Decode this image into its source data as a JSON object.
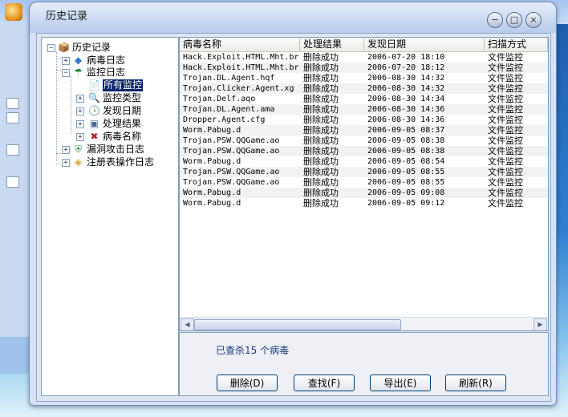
{
  "window": {
    "title": "历史记录"
  },
  "tree": {
    "root": "历史记录",
    "nodes": [
      {
        "label": "病毒日志"
      },
      {
        "label": "监控日志"
      },
      {
        "label": "所有监控"
      },
      {
        "label": "监控类型"
      },
      {
        "label": "发现日期"
      },
      {
        "label": "处理结果"
      },
      {
        "label": "病毒名称"
      },
      {
        "label": "漏洞攻击日志"
      },
      {
        "label": "注册表操作日志"
      }
    ]
  },
  "table": {
    "columns": [
      "病毒名称",
      "处理结果",
      "发现日期",
      "扫描方式"
    ],
    "rows": [
      [
        "Hack.Exploit.HTML.Mht.br",
        "删除成功",
        "2006-07-20 18:10",
        "文件监控"
      ],
      [
        "Hack.Exploit.HTML.Mht.br",
        "删除成功",
        "2006-07-20 18:12",
        "文件监控"
      ],
      [
        "Trojan.DL.Agent.hqf",
        "删除成功",
        "2006-08-30 14:32",
        "文件监控"
      ],
      [
        "Trojan.Clicker.Agent.xg",
        "删除成功",
        "2006-08-30 14:32",
        "文件监控"
      ],
      [
        "Trojan.Delf.aqo",
        "删除成功",
        "2006-08-30 14:34",
        "文件监控"
      ],
      [
        "Trojan.DL.Agent.ama",
        "删除成功",
        "2006-08-30 14:36",
        "文件监控"
      ],
      [
        "Dropper.Agent.cfg",
        "删除成功",
        "2006-08-30 14:36",
        "文件监控"
      ],
      [
        "Worm.Pabug.d",
        "删除成功",
        "2006-09-05 08:37",
        "文件监控"
      ],
      [
        "Trojan.PSW.QQGame.ao",
        "删除成功",
        "2006-09-05 08:38",
        "文件监控"
      ],
      [
        "Trojan.PSW.QQGame.ao",
        "删除成功",
        "2006-09-05 08:38",
        "文件监控"
      ],
      [
        "Worm.Pabug.d",
        "删除成功",
        "2006-09-05 08:54",
        "文件监控"
      ],
      [
        "Trojan.PSW.QQGame.ao",
        "删除成功",
        "2006-09-05 08:55",
        "文件监控"
      ],
      [
        "Trojan.PSW.QQGame.ao",
        "删除成功",
        "2006-09-05 08:55",
        "文件监控"
      ],
      [
        "Worm.Pabug.d",
        "删除成功",
        "2006-09-05 09:08",
        "文件监控"
      ],
      [
        "Worm.Pabug.d",
        "删除成功",
        "2006-09-05 09:12",
        "文件监控"
      ]
    ]
  },
  "status": {
    "text": "已查杀15 个病毒"
  },
  "buttons": {
    "delete": "删除(D)",
    "find": "查找(F)",
    "export": "导出(E)",
    "refresh": "刷新(R)"
  },
  "icons": {
    "minimize": "−",
    "maximize": "□",
    "close": "×"
  }
}
